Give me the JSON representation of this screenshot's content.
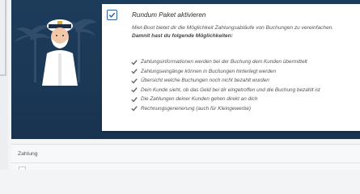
{
  "card": {
    "title": "Rundum Paket aktivieren",
    "checked": true,
    "intro": "Miet-Boot bietet dir die Möglichkeit Zahlungsabläufe von Buchungen zu vereinfachen.",
    "intro_strong": "Damnit hast du folgende Möglichkeiten:",
    "features": [
      "Zahlungsinformationen werden bei der Buchung dem Kunden übermittelt",
      "Zahlungseingänge können in Buchungen hinterlegt werden",
      "Übersicht welche Buchungen noch nicht bezahlt wurden",
      "Dein Kunde sieht, ob das Geld bei dir eingetroffen und die Buchung bezahlt ist",
      "Die Zahlungen deiner Kunden gehen direkt an dich",
      "Rechnungsgenerierung (auch für Kleingewerbe)"
    ]
  },
  "payment": {
    "label": "Zahlung"
  },
  "colors": {
    "banner": "#1b3856",
    "accent": "#2a5fa0",
    "feature_check": "#6b6b6b"
  },
  "icons": {
    "checkbox": "checkmark-icon",
    "feature": "feature-check-icon",
    "illustration": "palm-trees-captain-illustration"
  }
}
